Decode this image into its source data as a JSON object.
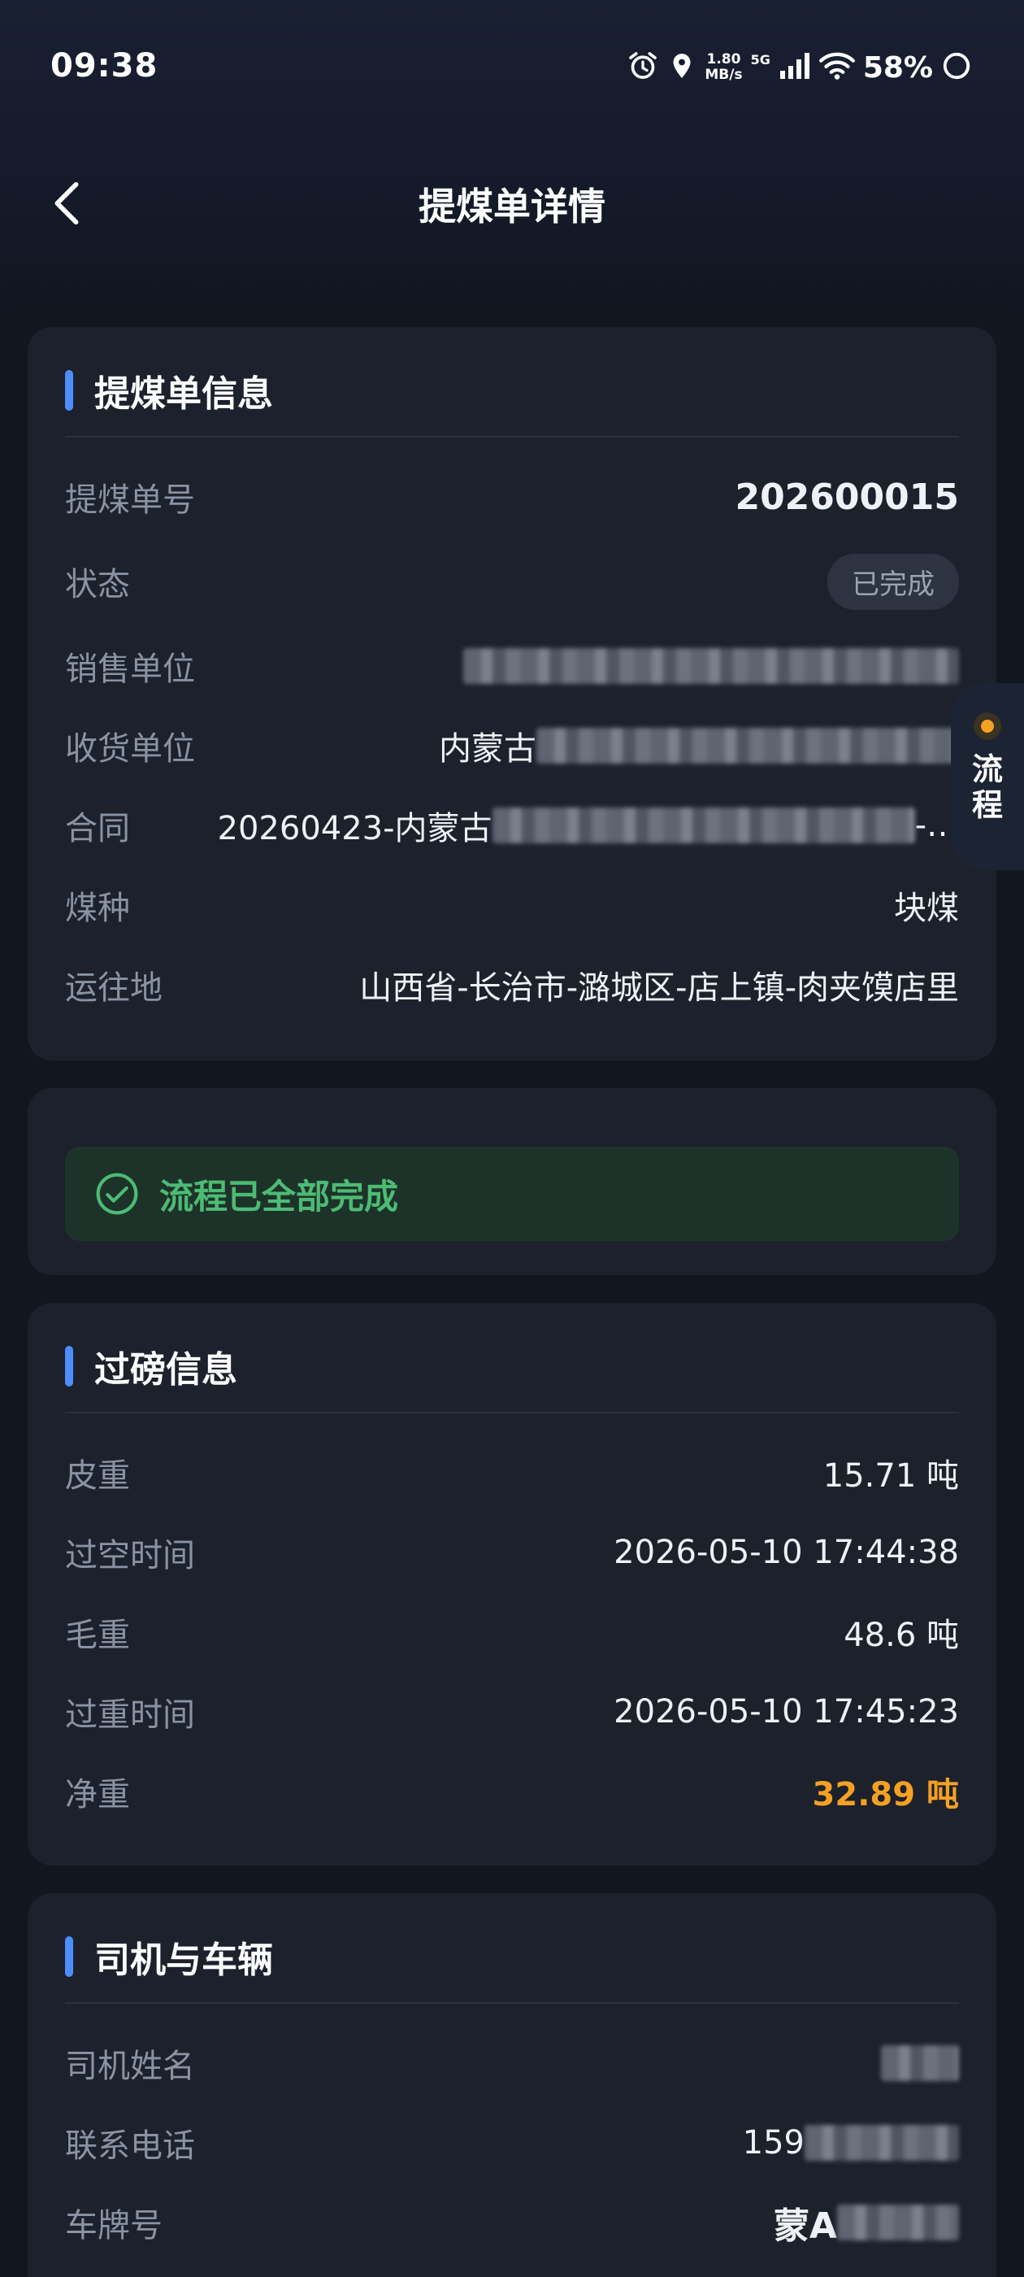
{
  "status_bar": {
    "time": "09:38",
    "speed_value": "1.80",
    "speed_unit": "MB/s",
    "network": "5G",
    "battery": "58%"
  },
  "nav": {
    "title": "提煤单详情"
  },
  "order_info": {
    "title": "提煤单信息",
    "order_no_label": "提煤单号",
    "order_no": "202600015",
    "status_label": "状态",
    "status": "已完成",
    "seller_label": "销售单位",
    "receiver_label": "收货单位",
    "receiver_prefix": "内蒙古",
    "contract_label": "合同",
    "contract_prefix": "20260423-内蒙古",
    "contract_suffix": "-…",
    "coal_type_label": "煤种",
    "coal_type": "块煤",
    "destination_label": "运往地",
    "destination": "山西省-长治市-潞城区-店上镇-肉夹馍店里"
  },
  "flow": {
    "completed_text": "流程已全部完成"
  },
  "weighing": {
    "title": "过磅信息",
    "tare_label": "皮重",
    "tare": "15.71 吨",
    "empty_time_label": "过空时间",
    "empty_time": "2026-05-10 17:44:38",
    "gross_label": "毛重",
    "gross": "48.6 吨",
    "gross_time_label": "过重时间",
    "gross_time": "2026-05-10 17:45:23",
    "net_label": "净重",
    "net": "32.89 吨"
  },
  "driver": {
    "title": "司机与车辆",
    "name_label": "司机姓名",
    "phone_label": "联系电话",
    "phone_prefix": "159",
    "plate_label": "车牌号",
    "plate_prefix": "蒙A"
  },
  "float_tab": {
    "label": "流程"
  },
  "colors": {
    "accent": "#4d8dff",
    "success": "#4dbb74",
    "net_weight": "#f5a023",
    "card": "#1c212c"
  }
}
